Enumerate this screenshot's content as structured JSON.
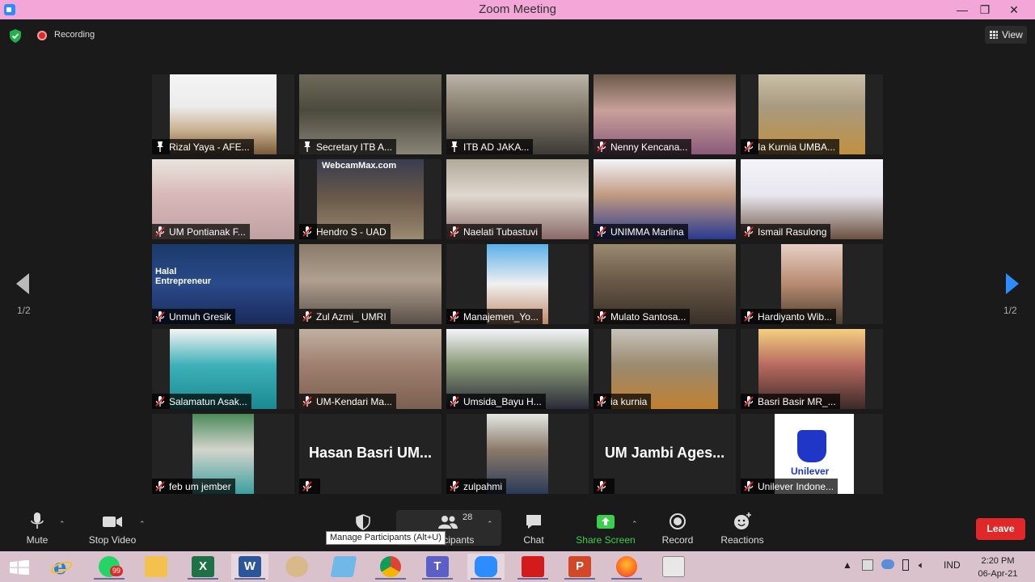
{
  "window": {
    "title": "Zoom Meeting",
    "min": "—",
    "max": "❐",
    "close": "✕"
  },
  "status": {
    "recording": "Recording",
    "view": "View"
  },
  "pagination": {
    "left": "1/2",
    "right": "1/2"
  },
  "tiles": [
    {
      "name": "Rizal Yaya - AFE...",
      "mic": "pin"
    },
    {
      "name": "Secretary ITB A...",
      "mic": "pin",
      "active": true
    },
    {
      "name": "ITB AD JAKA...",
      "mic": "pin"
    },
    {
      "name": "Nenny Kencana...",
      "mic": "muted"
    },
    {
      "name": "Ia Kurnia UMBA...",
      "mic": "muted"
    },
    {
      "name": "UM Pontianak F...",
      "mic": "muted"
    },
    {
      "name": "Hendro S - UAD",
      "mic": "muted"
    },
    {
      "name": "Naelati Tubastuvi",
      "mic": "muted"
    },
    {
      "name": "UNIMMA Marlina",
      "mic": "muted"
    },
    {
      "name": "Ismail Rasulong",
      "mic": "muted"
    },
    {
      "name": "Unmuh Gresik",
      "mic": "muted"
    },
    {
      "name": "Zul Azmi_ UMRI",
      "mic": "muted"
    },
    {
      "name": "Manajemen_Yo...",
      "mic": "muted"
    },
    {
      "name": "Mulato Santosa...",
      "mic": "muted"
    },
    {
      "name": "Hardiyanto Wib...",
      "mic": "muted"
    },
    {
      "name": "Salamatun Asak...",
      "mic": "muted"
    },
    {
      "name": "UM-Kendari Ma...",
      "mic": "muted"
    },
    {
      "name": "Umsida_Bayu H...",
      "mic": "muted"
    },
    {
      "name": "ia kurnia",
      "mic": "muted"
    },
    {
      "name": "Basri Basir MR_...",
      "mic": "muted"
    },
    {
      "name": "feb um jember",
      "mic": "muted"
    },
    {
      "name": "",
      "mic": "muted",
      "big": "Hasan Basri UM..."
    },
    {
      "name": "zulpahmi",
      "mic": "muted"
    },
    {
      "name": "",
      "mic": "muted",
      "big": "UM Jambi Ages..."
    },
    {
      "name": "Unilever Indone...",
      "mic": "muted"
    }
  ],
  "tile_content": {
    "halal_line1": "Halal",
    "halal_line2": "Entrepreneur",
    "webcam": "WebcamMax.com",
    "unilever": "Unilever"
  },
  "toolbar": {
    "mute": "Mute",
    "stop_video": "Stop Video",
    "participants_count": "28",
    "participants": "Participants",
    "chat": "Chat",
    "share": "Share Screen",
    "record": "Record",
    "reactions": "Reactions",
    "leave": "Leave",
    "tooltip": "Manage Participants (Alt+U)"
  },
  "taskbar": {
    "whatsapp_badge": "99",
    "lang": "IND",
    "time": "2:20 PM",
    "date": "06-Apr-21"
  },
  "colors": {
    "titlebar": "#f3a7d8",
    "accent_blue": "#2d8cff",
    "active_speaker": "#c5e15a",
    "leave_red": "#e02828",
    "share_green": "#3ccf4e"
  }
}
